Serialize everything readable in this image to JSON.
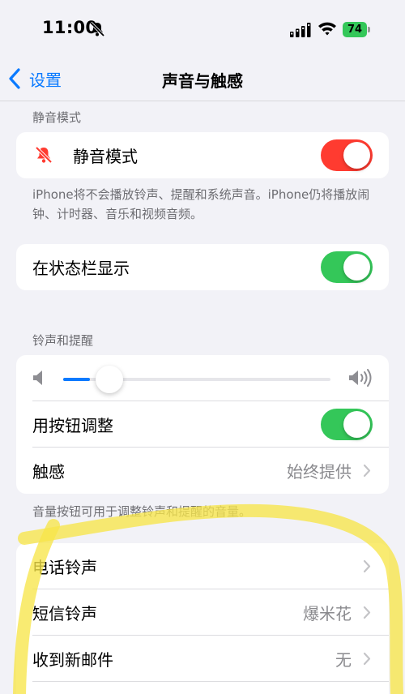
{
  "status_bar": {
    "time": "11:00",
    "battery": "74"
  },
  "nav": {
    "back_label": "设置",
    "title": "声音与触感"
  },
  "silent_section": {
    "header": "静音模式",
    "silent_mode": {
      "label": "静音模式",
      "on": true,
      "toggle_color": "#ff3b30"
    },
    "footer": "iPhone将不会播放铃声、提醒和系统声音。iPhone仍将播放闹钟、计时器、音乐和视频音频。"
  },
  "status_bar_display": {
    "label": "在状态栏显示",
    "on": true,
    "toggle_color": "#34c759"
  },
  "ringer_section": {
    "header": "铃声和提醒",
    "volume_level": 0.07,
    "adjust_with_buttons": {
      "label": "用按钮调整",
      "on": true
    },
    "haptics": {
      "label": "触感",
      "value": "始终提供"
    },
    "footer": "音量按钮可用于调整铃声和提醒的音量。"
  },
  "sounds_section": {
    "items": [
      {
        "label": "电话铃声",
        "value": ""
      },
      {
        "label": "短信铃声",
        "value": "爆米花"
      },
      {
        "label": "收到新邮件",
        "value": "无"
      }
    ]
  },
  "colors": {
    "accent": "#0a7aff",
    "green": "#34c759",
    "red": "#ff3b30",
    "highlighter": "#f7e64a"
  },
  "icons": [
    "bell-slash-icon",
    "signal-icon",
    "wifi-icon",
    "battery-icon",
    "chevron-left-icon",
    "speaker-low-icon",
    "speaker-high-icon",
    "chevron-right-icon"
  ]
}
